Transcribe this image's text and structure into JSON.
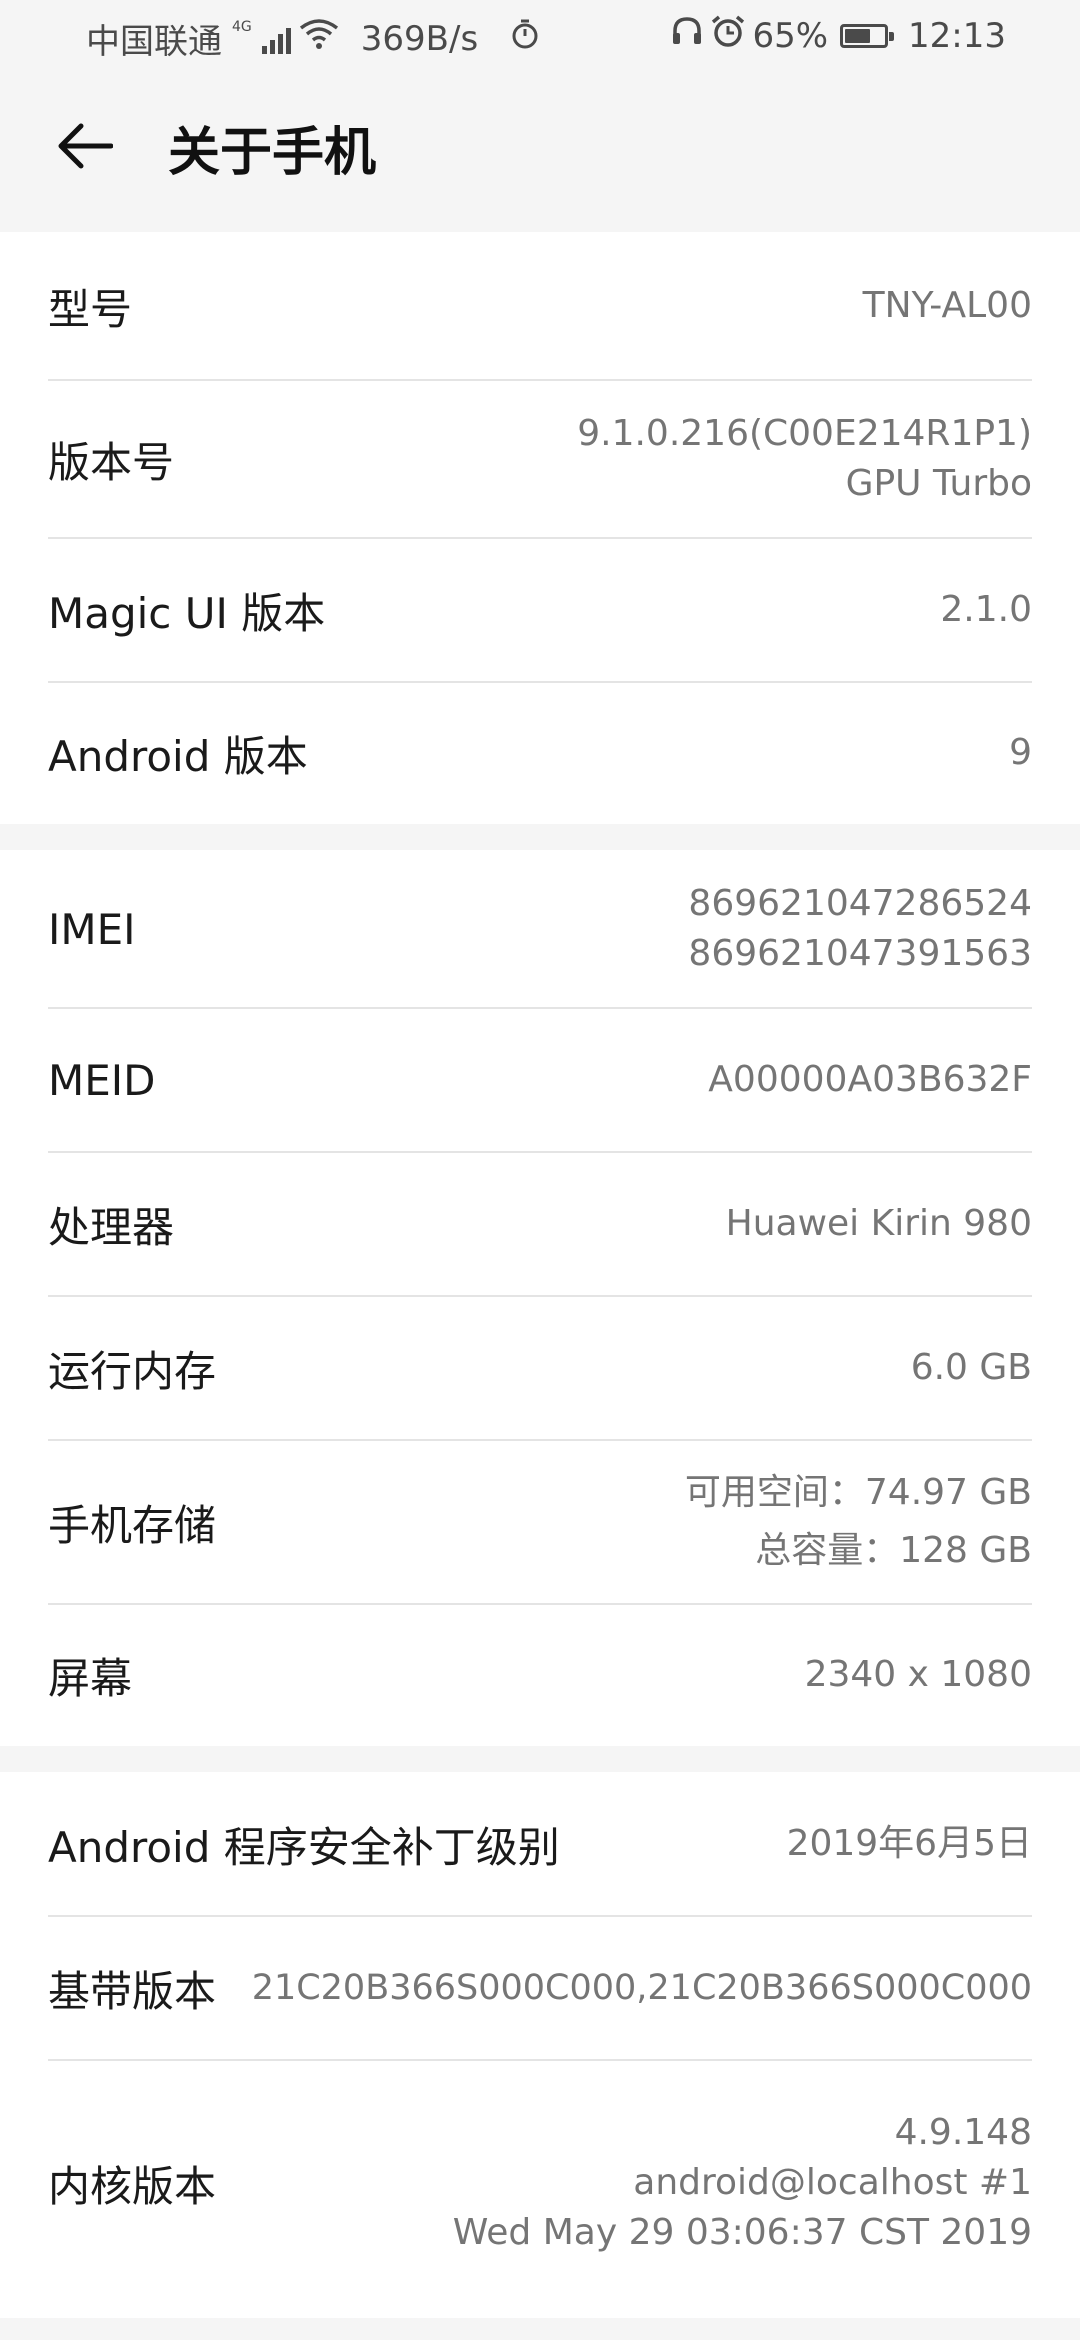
{
  "status_bar": {
    "carrier": "中国联通",
    "network": "4G",
    "speed": "369B/s",
    "battery": "65%",
    "battery_level": 0.65,
    "time": "12:13"
  },
  "header": {
    "title": "关于手机",
    "back_icon": "arrow-left-icon"
  },
  "group1": {
    "model": {
      "label": "型号",
      "value": "TNY-AL00"
    },
    "build": {
      "label": "版本号",
      "value_line1": "9.1.0.216(C00E214R1P1)",
      "value_line2": "GPU Turbo"
    },
    "magic_ui": {
      "label": "Magic UI 版本",
      "value": "2.1.0"
    },
    "android": {
      "label": "Android 版本",
      "value": "9"
    }
  },
  "group2": {
    "imei": {
      "label": "IMEI",
      "value_line1": "869621047286524",
      "value_line2": "869621047391563"
    },
    "meid": {
      "label": "MEID",
      "value": "A00000A03B632F"
    },
    "processor": {
      "label": "处理器",
      "value": "Huawei Kirin 980"
    },
    "ram": {
      "label": "运行内存",
      "value": "6.0 GB"
    },
    "storage": {
      "label": "手机存储",
      "value_line1": "可用空间：74.97  GB",
      "value_line2": "总容量：128  GB"
    },
    "screen": {
      "label": "屏幕",
      "value": "2340 x 1080"
    }
  },
  "group3": {
    "patch": {
      "label": "Android 程序安全补丁级别",
      "value": "2019年6月5日"
    },
    "baseband": {
      "label": "基带版本",
      "value": "21C20B366S000C000,21C20B366S000C000"
    },
    "kernel": {
      "label": "内核版本",
      "value_line1": "4.9.148",
      "value_line2": "android@localhost #1",
      "value_line3": "Wed May 29 03:06:37 CST 2019"
    }
  }
}
